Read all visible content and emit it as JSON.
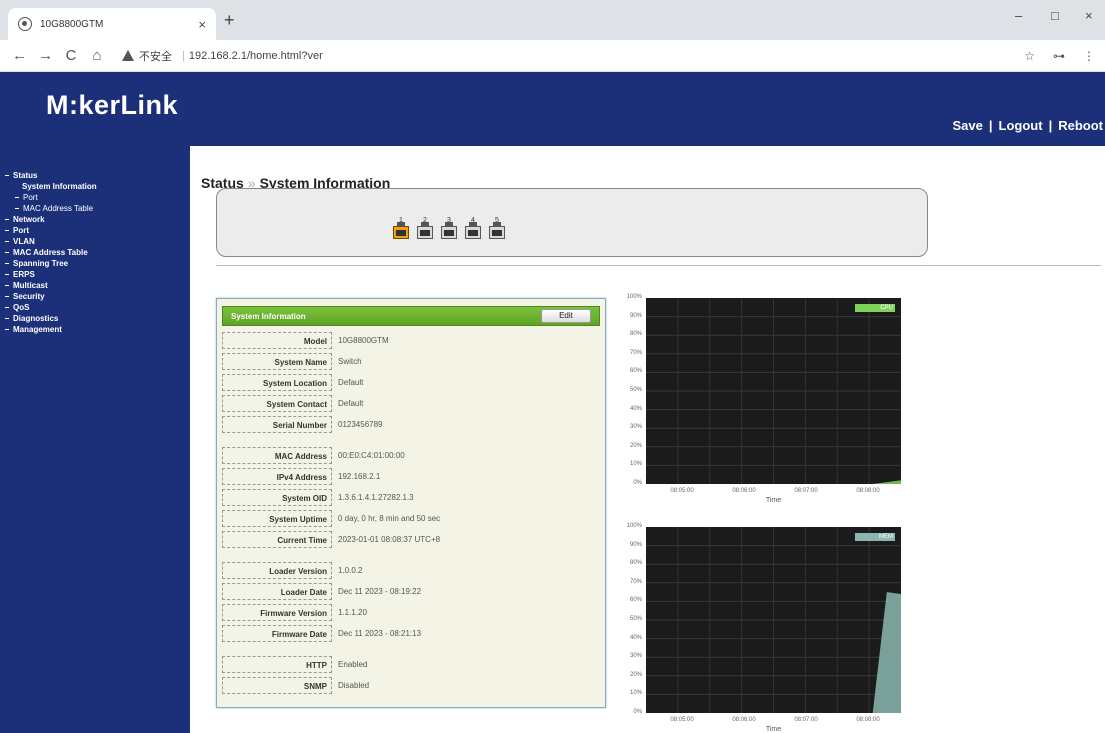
{
  "browser": {
    "tab_title": "10G8800GTM",
    "tab_close": "×",
    "new_tab": "+",
    "win_min": "–",
    "win_max": "□",
    "win_close": "×",
    "back": "←",
    "forward": "→",
    "reload": "C",
    "home": "⌂",
    "insecure_label": "不安全",
    "url": "192.168.2.1/home.html?ver",
    "star": "☆",
    "key": "⊶",
    "menu": "⋮"
  },
  "header": {
    "logo": "M:kerLink",
    "links": {
      "save": "Save",
      "logout": "Logout",
      "reboot": "Reboot",
      "separator": "|"
    }
  },
  "sidebar": {
    "items": [
      {
        "label": "Status",
        "level": 0
      },
      {
        "label": "System Information",
        "level": 2
      },
      {
        "label": "Port",
        "level": 1
      },
      {
        "label": "MAC Address Table",
        "level": 1
      },
      {
        "label": "Network",
        "level": 0
      },
      {
        "label": "Port",
        "level": 0
      },
      {
        "label": "VLAN",
        "level": 0
      },
      {
        "label": "MAC Address Table",
        "level": 0
      },
      {
        "label": "Spanning Tree",
        "level": 0
      },
      {
        "label": "ERPS",
        "level": 0
      },
      {
        "label": "Multicast",
        "level": 0
      },
      {
        "label": "Security",
        "level": 0
      },
      {
        "label": "QoS",
        "level": 0
      },
      {
        "label": "Diagnostics",
        "level": 0
      },
      {
        "label": "Management",
        "level": 0
      }
    ]
  },
  "breadcrumb": {
    "section": "Status",
    "arrow": "»",
    "page": "System Information"
  },
  "ports": [
    {
      "num": "1",
      "active": true
    },
    {
      "num": "2",
      "active": false
    },
    {
      "num": "3",
      "active": false
    },
    {
      "num": "4",
      "active": false
    },
    {
      "num": "5",
      "active": false
    }
  ],
  "info": {
    "title": "System Information",
    "edit_label": "Edit",
    "rows": [
      {
        "key": "Model",
        "value": "10G8800GTM"
      },
      {
        "key": "System Name",
        "value": "Switch"
      },
      {
        "key": "System Location",
        "value": "Default"
      },
      {
        "key": "System Contact",
        "value": "Default"
      },
      {
        "key": "Serial Number",
        "value": "0123456789"
      },
      {
        "key": "MAC Address",
        "value": "00:E0:C4:01:00:00"
      },
      {
        "key": "IPv4 Address",
        "value": "192.168.2.1"
      },
      {
        "key": "System OID",
        "value": "1.3.6.1.4.1.27282.1.3"
      },
      {
        "key": "System Uptime",
        "value": "0 day, 0 hr, 8 min and 50 sec"
      },
      {
        "key": "Current Time",
        "value": "2023-01-01 08:08:37 UTC+8"
      },
      {
        "key": "Loader Version",
        "value": "1.0.0.2"
      },
      {
        "key": "Loader Date",
        "value": "Dec 11 2023 - 08:19:22"
      },
      {
        "key": "Firmware Version",
        "value": "1.1.1.20"
      },
      {
        "key": "Firmware Date",
        "value": "Dec 11 2023 - 08:21:13"
      },
      {
        "key": "HTTP",
        "value": "Enabled"
      },
      {
        "key": "SNMP",
        "value": "Disabled"
      }
    ]
  },
  "chart_data": [
    {
      "type": "area",
      "legend": "CPU",
      "color": "#7fd35a",
      "xlabel": "Time",
      "yticks": [
        "100%",
        "90%",
        "80%",
        "70%",
        "60%",
        "50%",
        "40%",
        "30%",
        "20%",
        "10%",
        "0%"
      ],
      "xticks": [
        "08:05:00",
        "08:06:00",
        "08:07:00",
        "08:08:00"
      ],
      "ylim": [
        0,
        100
      ],
      "series": [
        {
          "values": [
            0,
            0,
            0,
            0,
            0,
            0,
            0,
            0,
            0,
            0,
            0,
            0,
            0,
            0,
            0,
            0,
            0,
            1,
            2
          ]
        }
      ]
    },
    {
      "type": "area",
      "legend": "MEM",
      "color": "#8ab8b0",
      "xlabel": "Time",
      "yticks": [
        "100%",
        "90%",
        "80%",
        "70%",
        "60%",
        "50%",
        "40%",
        "30%",
        "20%",
        "10%",
        "0%"
      ],
      "xticks": [
        "08:05:00",
        "08:06:00",
        "08:07:00",
        "08:08:00"
      ],
      "ylim": [
        0,
        100
      ],
      "series": [
        {
          "values": [
            0,
            0,
            0,
            0,
            0,
            0,
            0,
            0,
            0,
            0,
            0,
            0,
            0,
            0,
            0,
            0,
            0,
            65,
            64
          ]
        }
      ]
    }
  ]
}
